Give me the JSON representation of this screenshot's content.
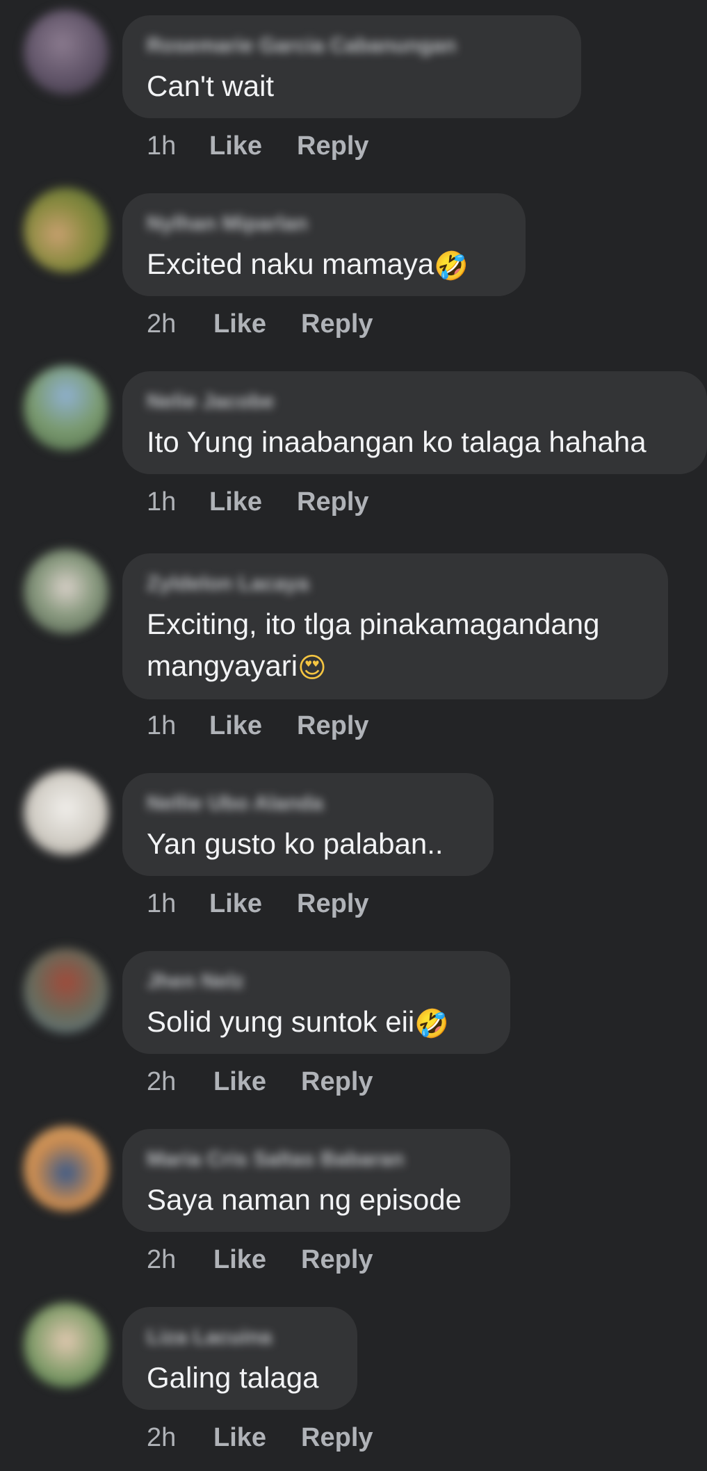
{
  "comments": [
    {
      "name": "Rosemarie Garcia Cabanungan",
      "text": "Can't wait",
      "emoji": "",
      "time": "1h",
      "like": "Like",
      "reply": "Reply",
      "avatar_color": "#6b5e70"
    },
    {
      "name": "Nylhan Miparlan",
      "text": "Excited naku mamaya",
      "emoji": "🤣",
      "time": "2h",
      "like": "Like",
      "reply": "Reply",
      "avatar_color": "#8a7f4a"
    },
    {
      "name": "Nelie Jacobe",
      "text": "Ito Yung inaabangan ko talaga hahaha",
      "emoji": "",
      "time": "1h",
      "like": "Like",
      "reply": "Reply",
      "avatar_color": "#6f8a6a"
    },
    {
      "name": "Zyldelon Lacaya",
      "text": "Exciting, ito tlga pinakamagandang\nmangyayari",
      "emoji": "😍",
      "time": "1h",
      "like": "Like",
      "reply": "Reply",
      "avatar_color": "#7c8a7c"
    },
    {
      "name": "Nellie Ubo Alanda",
      "text": "Yan gusto ko palaban..",
      "emoji": "",
      "time": "1h",
      "like": "Like",
      "reply": "Reply",
      "avatar_color": "#c9c6c0"
    },
    {
      "name": "Jhen Nelz",
      "text": "Solid yung suntok eii",
      "emoji": "🤣",
      "time": "2h",
      "like": "Like",
      "reply": "Reply",
      "avatar_color": "#6e5a4a"
    },
    {
      "name": "Maria Cris Saltas Babaran",
      "text": "Saya naman ng episode",
      "emoji": "",
      "time": "2h",
      "like": "Like",
      "reply": "Reply",
      "avatar_color": "#9a7a55"
    },
    {
      "name": "Liza Lacuina",
      "text": "Galing talaga",
      "emoji": "",
      "time": "2h",
      "like": "Like",
      "reply": "Reply",
      "avatar_color": "#7a8a6a"
    }
  ]
}
